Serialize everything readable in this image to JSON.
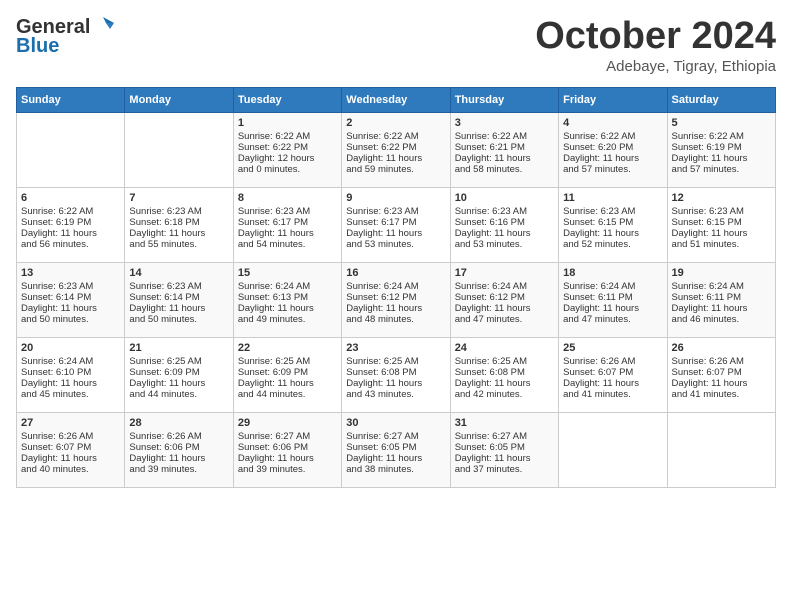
{
  "header": {
    "logo_general": "General",
    "logo_blue": "Blue",
    "title": "October 2024",
    "subtitle": "Adebaye, Tigray, Ethiopia"
  },
  "calendar": {
    "days_of_week": [
      "Sunday",
      "Monday",
      "Tuesday",
      "Wednesday",
      "Thursday",
      "Friday",
      "Saturday"
    ],
    "weeks": [
      [
        {
          "day": "",
          "lines": []
        },
        {
          "day": "",
          "lines": []
        },
        {
          "day": "1",
          "lines": [
            "Sunrise: 6:22 AM",
            "Sunset: 6:22 PM",
            "Daylight: 12 hours",
            "and 0 minutes."
          ]
        },
        {
          "day": "2",
          "lines": [
            "Sunrise: 6:22 AM",
            "Sunset: 6:22 PM",
            "Daylight: 11 hours",
            "and 59 minutes."
          ]
        },
        {
          "day": "3",
          "lines": [
            "Sunrise: 6:22 AM",
            "Sunset: 6:21 PM",
            "Daylight: 11 hours",
            "and 58 minutes."
          ]
        },
        {
          "day": "4",
          "lines": [
            "Sunrise: 6:22 AM",
            "Sunset: 6:20 PM",
            "Daylight: 11 hours",
            "and 57 minutes."
          ]
        },
        {
          "day": "5",
          "lines": [
            "Sunrise: 6:22 AM",
            "Sunset: 6:19 PM",
            "Daylight: 11 hours",
            "and 57 minutes."
          ]
        }
      ],
      [
        {
          "day": "6",
          "lines": [
            "Sunrise: 6:22 AM",
            "Sunset: 6:19 PM",
            "Daylight: 11 hours",
            "and 56 minutes."
          ]
        },
        {
          "day": "7",
          "lines": [
            "Sunrise: 6:23 AM",
            "Sunset: 6:18 PM",
            "Daylight: 11 hours",
            "and 55 minutes."
          ]
        },
        {
          "day": "8",
          "lines": [
            "Sunrise: 6:23 AM",
            "Sunset: 6:17 PM",
            "Daylight: 11 hours",
            "and 54 minutes."
          ]
        },
        {
          "day": "9",
          "lines": [
            "Sunrise: 6:23 AM",
            "Sunset: 6:17 PM",
            "Daylight: 11 hours",
            "and 53 minutes."
          ]
        },
        {
          "day": "10",
          "lines": [
            "Sunrise: 6:23 AM",
            "Sunset: 6:16 PM",
            "Daylight: 11 hours",
            "and 53 minutes."
          ]
        },
        {
          "day": "11",
          "lines": [
            "Sunrise: 6:23 AM",
            "Sunset: 6:15 PM",
            "Daylight: 11 hours",
            "and 52 minutes."
          ]
        },
        {
          "day": "12",
          "lines": [
            "Sunrise: 6:23 AM",
            "Sunset: 6:15 PM",
            "Daylight: 11 hours",
            "and 51 minutes."
          ]
        }
      ],
      [
        {
          "day": "13",
          "lines": [
            "Sunrise: 6:23 AM",
            "Sunset: 6:14 PM",
            "Daylight: 11 hours",
            "and 50 minutes."
          ]
        },
        {
          "day": "14",
          "lines": [
            "Sunrise: 6:23 AM",
            "Sunset: 6:14 PM",
            "Daylight: 11 hours",
            "and 50 minutes."
          ]
        },
        {
          "day": "15",
          "lines": [
            "Sunrise: 6:24 AM",
            "Sunset: 6:13 PM",
            "Daylight: 11 hours",
            "and 49 minutes."
          ]
        },
        {
          "day": "16",
          "lines": [
            "Sunrise: 6:24 AM",
            "Sunset: 6:12 PM",
            "Daylight: 11 hours",
            "and 48 minutes."
          ]
        },
        {
          "day": "17",
          "lines": [
            "Sunrise: 6:24 AM",
            "Sunset: 6:12 PM",
            "Daylight: 11 hours",
            "and 47 minutes."
          ]
        },
        {
          "day": "18",
          "lines": [
            "Sunrise: 6:24 AM",
            "Sunset: 6:11 PM",
            "Daylight: 11 hours",
            "and 47 minutes."
          ]
        },
        {
          "day": "19",
          "lines": [
            "Sunrise: 6:24 AM",
            "Sunset: 6:11 PM",
            "Daylight: 11 hours",
            "and 46 minutes."
          ]
        }
      ],
      [
        {
          "day": "20",
          "lines": [
            "Sunrise: 6:24 AM",
            "Sunset: 6:10 PM",
            "Daylight: 11 hours",
            "and 45 minutes."
          ]
        },
        {
          "day": "21",
          "lines": [
            "Sunrise: 6:25 AM",
            "Sunset: 6:09 PM",
            "Daylight: 11 hours",
            "and 44 minutes."
          ]
        },
        {
          "day": "22",
          "lines": [
            "Sunrise: 6:25 AM",
            "Sunset: 6:09 PM",
            "Daylight: 11 hours",
            "and 44 minutes."
          ]
        },
        {
          "day": "23",
          "lines": [
            "Sunrise: 6:25 AM",
            "Sunset: 6:08 PM",
            "Daylight: 11 hours",
            "and 43 minutes."
          ]
        },
        {
          "day": "24",
          "lines": [
            "Sunrise: 6:25 AM",
            "Sunset: 6:08 PM",
            "Daylight: 11 hours",
            "and 42 minutes."
          ]
        },
        {
          "day": "25",
          "lines": [
            "Sunrise: 6:26 AM",
            "Sunset: 6:07 PM",
            "Daylight: 11 hours",
            "and 41 minutes."
          ]
        },
        {
          "day": "26",
          "lines": [
            "Sunrise: 6:26 AM",
            "Sunset: 6:07 PM",
            "Daylight: 11 hours",
            "and 41 minutes."
          ]
        }
      ],
      [
        {
          "day": "27",
          "lines": [
            "Sunrise: 6:26 AM",
            "Sunset: 6:07 PM",
            "Daylight: 11 hours",
            "and 40 minutes."
          ]
        },
        {
          "day": "28",
          "lines": [
            "Sunrise: 6:26 AM",
            "Sunset: 6:06 PM",
            "Daylight: 11 hours",
            "and 39 minutes."
          ]
        },
        {
          "day": "29",
          "lines": [
            "Sunrise: 6:27 AM",
            "Sunset: 6:06 PM",
            "Daylight: 11 hours",
            "and 39 minutes."
          ]
        },
        {
          "day": "30",
          "lines": [
            "Sunrise: 6:27 AM",
            "Sunset: 6:05 PM",
            "Daylight: 11 hours",
            "and 38 minutes."
          ]
        },
        {
          "day": "31",
          "lines": [
            "Sunrise: 6:27 AM",
            "Sunset: 6:05 PM",
            "Daylight: 11 hours",
            "and 37 minutes."
          ]
        },
        {
          "day": "",
          "lines": []
        },
        {
          "day": "",
          "lines": []
        }
      ]
    ]
  }
}
